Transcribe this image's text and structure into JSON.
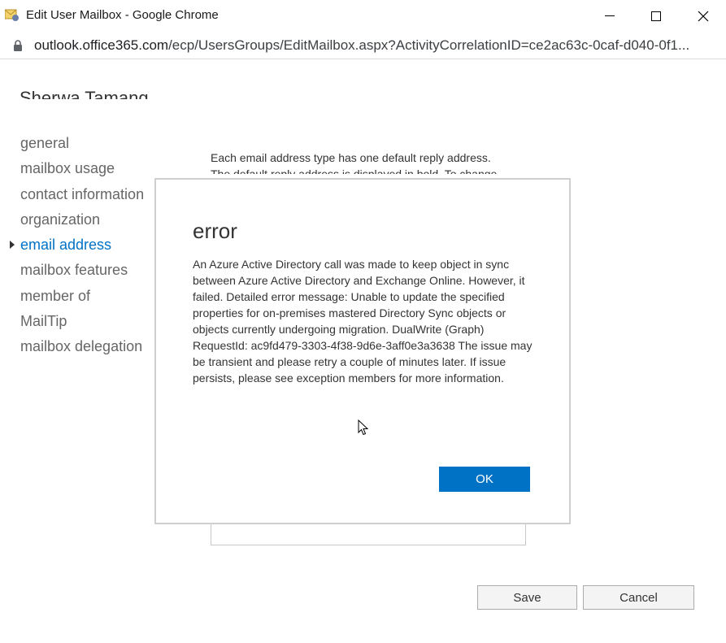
{
  "window": {
    "title": "Edit User Mailbox - Google Chrome",
    "controls": {
      "minimize": "minimize-icon",
      "maximize": "maximize-icon",
      "close": "close-icon"
    }
  },
  "address_bar": {
    "host": "outlook.office365.com",
    "path": "/ecp/UsersGroups/EditMailbox.aspx?ActivityCorrelationID=ce2ac63c-0caf-d040-0f1..."
  },
  "user": {
    "name": "Sherwa Tamang"
  },
  "nav": {
    "items": [
      {
        "label": "general",
        "active": false
      },
      {
        "label": "mailbox usage",
        "active": false
      },
      {
        "label": "contact information",
        "active": false
      },
      {
        "label": "organization",
        "active": false
      },
      {
        "label": "email address",
        "active": true
      },
      {
        "label": "mailbox features",
        "active": false
      },
      {
        "label": "member of",
        "active": false
      },
      {
        "label": "MailTip",
        "active": false
      },
      {
        "label": "mailbox delegation",
        "active": false
      }
    ]
  },
  "content": {
    "line1": "Each email address type has one default reply address.",
    "line2": "The default reply address is displayed in bold. To change"
  },
  "dialog": {
    "title": "error",
    "message": "An Azure Active Directory call was made to keep object in sync between Azure Active Directory and Exchange Online. However, it failed. Detailed error message: Unable to update the specified properties for on-premises mastered Directory Sync objects or objects currently undergoing migration. DualWrite (Graph) RequestId: ac9fd479-3303-4f38-9d6e-3aff0e3a3638 The issue may be transient and please retry a couple of minutes later. If issue persists, please see exception members for more information.",
    "ok_label": "OK"
  },
  "footer": {
    "save_label": "Save",
    "cancel_label": "Cancel"
  },
  "colors": {
    "accent": "#0072c6",
    "text": "#333333",
    "nav_text": "#666666"
  }
}
